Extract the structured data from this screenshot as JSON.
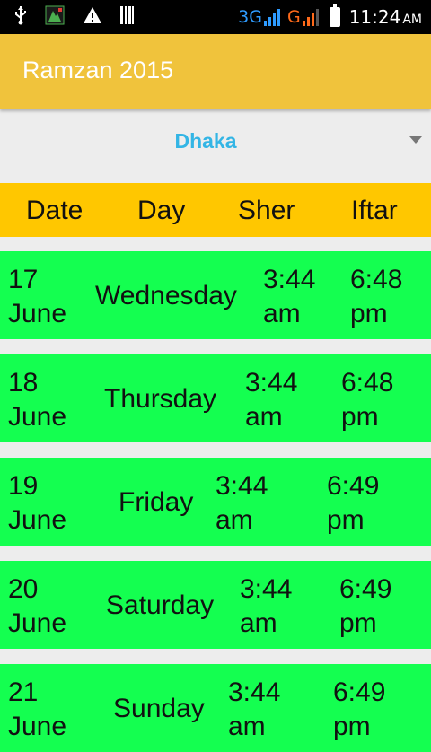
{
  "status_bar": {
    "icons": [
      "usb-icon",
      "app-notification-icon",
      "warning-icon",
      "barcode-icon"
    ],
    "network1": "3G",
    "network2": "G",
    "time": "11:24",
    "ampm": "AM"
  },
  "app_bar": {
    "title": "Ramzan 2015"
  },
  "city_selector": {
    "selected": "Dhaka"
  },
  "table": {
    "headers": {
      "date": "Date",
      "day": "Day",
      "sher": "Sher",
      "iftar": "Iftar"
    },
    "rows": [
      {
        "date": "17\nJune",
        "day": "Wednesday",
        "sher": "3:44\nam",
        "iftar": "6:48\npm"
      },
      {
        "date": "18\nJune",
        "day": "Thursday",
        "sher": "3:44\nam",
        "iftar": "6:48\npm"
      },
      {
        "date": "19\nJune",
        "day": "Friday",
        "sher": "3:44\nam",
        "iftar": "6:49\npm"
      },
      {
        "date": "20\nJune",
        "day": "Saturday",
        "sher": "3:44\nam",
        "iftar": "6:49\npm"
      },
      {
        "date": "21\nJune",
        "day": "Sunday",
        "sher": "3:44\nam",
        "iftar": "6:49\npm"
      }
    ]
  },
  "colors": {
    "app_bar": "#f0c33c",
    "header": "#ffc700",
    "row": "#14ff50",
    "city_text": "#33b5e5",
    "background": "#ededed"
  }
}
